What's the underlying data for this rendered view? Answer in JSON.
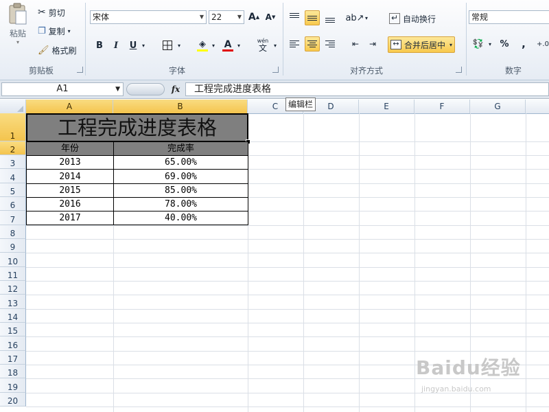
{
  "ribbon": {
    "clipboard": {
      "paste": "粘贴",
      "cut": "剪切",
      "copy": "复制",
      "format_painter": "格式刷",
      "group_label": "剪贴板"
    },
    "font": {
      "font_name": "宋体",
      "font_size": "22",
      "group_label": "字体",
      "bold": "B",
      "italic": "I",
      "underline": "U",
      "phonetic": "wén"
    },
    "alignment": {
      "wrap_text": "自动换行",
      "merge_center": "合并后居中",
      "group_label": "对齐方式"
    },
    "number": {
      "format": "常规",
      "percent": "%",
      "comma": ",",
      "group_label": "数字"
    }
  },
  "formula_bar": {
    "name_box": "A1",
    "fx": "fx",
    "content": "工程完成进度表格",
    "tooltip": "编辑栏"
  },
  "columns": [
    "A",
    "B",
    "C",
    "D",
    "E",
    "F",
    "G"
  ],
  "rows": [
    "1",
    "2",
    "3",
    "4",
    "5",
    "6",
    "7",
    "8",
    "9",
    "10",
    "11",
    "12",
    "13",
    "14",
    "15",
    "16",
    "17",
    "18",
    "19",
    "20"
  ],
  "sheet": {
    "title": "工程完成进度表格",
    "headers": [
      "年份",
      "完成率"
    ],
    "data": [
      [
        "2013",
        "65.00%"
      ],
      [
        "2014",
        "69.00%"
      ],
      [
        "2015",
        "85.00%"
      ],
      [
        "2016",
        "78.00%"
      ],
      [
        "2017",
        "40.00%"
      ]
    ]
  },
  "colors": {
    "title_fill": "#7f7f7f",
    "header_fill": "#808080",
    "selection": "#f6c955"
  },
  "watermark": {
    "brand": "Baidu经验",
    "url": "jingyan.baidu.com"
  }
}
